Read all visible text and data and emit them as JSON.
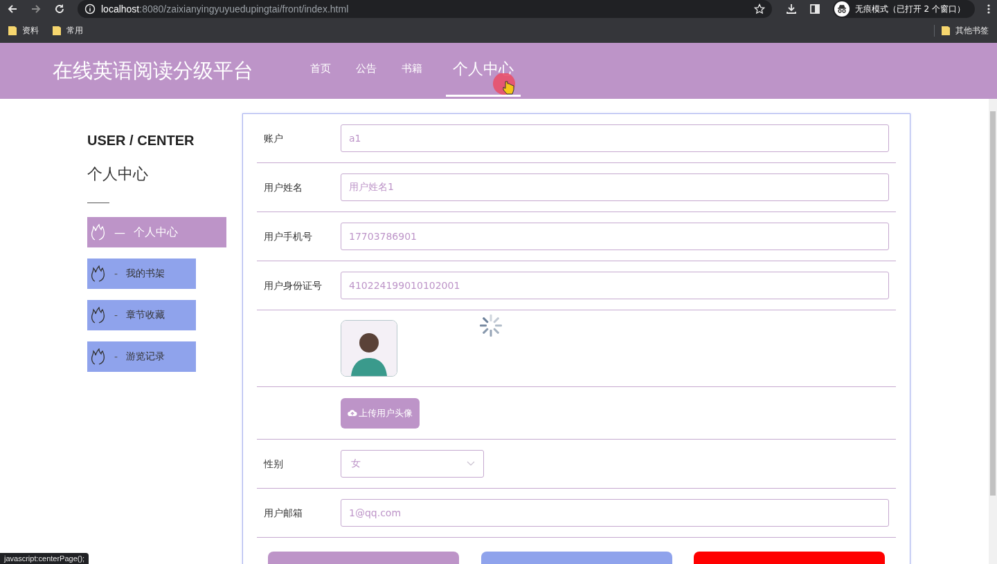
{
  "browser": {
    "url_host": "localhost",
    "url_path": ":8080/zaixianyingyuyuedupingtai/front/index.html",
    "profile_label": "无痕模式（已打开 2 个窗口）",
    "bookmarks": [
      "资料",
      "常用"
    ],
    "other_bookmarks": "其他书签"
  },
  "header": {
    "title": "在线英语阅读分级平台",
    "nav": [
      {
        "label": "首页",
        "selected": false
      },
      {
        "label": "公告",
        "selected": false
      },
      {
        "label": "书籍",
        "selected": false
      },
      {
        "label": "个人中心",
        "selected": true
      }
    ]
  },
  "sidebar": {
    "subtitle": "USER / CENTER",
    "title": "个人中心",
    "items": [
      {
        "marker": "—",
        "label": "个人中心",
        "selected": true
      },
      {
        "marker": "-",
        "label": "我的书架",
        "selected": false
      },
      {
        "marker": "-",
        "label": "章节收藏",
        "selected": false
      },
      {
        "marker": "-",
        "label": "游览记录",
        "selected": false
      }
    ]
  },
  "form": {
    "rows": [
      {
        "kind": "input",
        "label": "账户",
        "value": "a1"
      },
      {
        "kind": "input",
        "label": "用户姓名",
        "value": "用户姓名1"
      },
      {
        "kind": "input",
        "label": "用户手机号",
        "value": "17703786901"
      },
      {
        "kind": "input",
        "label": "用户身份证号",
        "value": "410224199010102001"
      },
      {
        "kind": "avatar"
      },
      {
        "kind": "upload",
        "button": "上传用户头像"
      },
      {
        "kind": "select",
        "label": "性别",
        "value": "女"
      },
      {
        "kind": "input",
        "label": "用户邮箱",
        "value": "1@qq.com"
      }
    ],
    "buttons": [
      {
        "color": "#bd94c8"
      },
      {
        "color": "#8fa3ec"
      },
      {
        "color": "#ff0000"
      }
    ]
  },
  "status_link": "javascript:centerPage();"
}
